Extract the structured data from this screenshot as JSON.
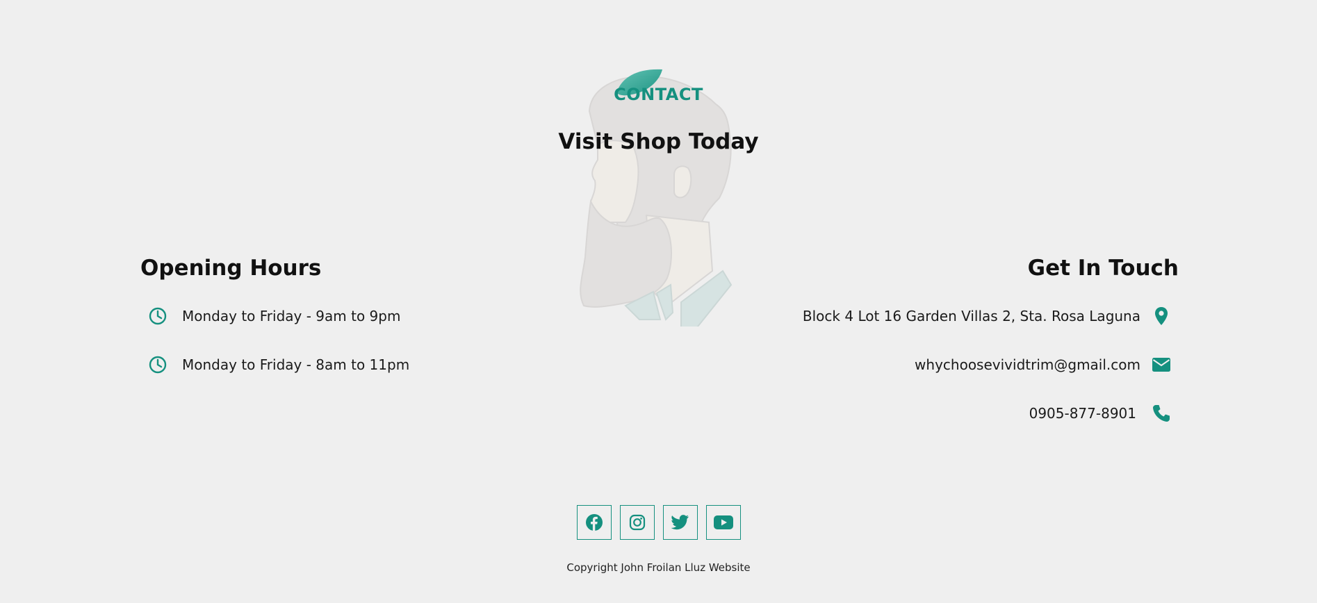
{
  "colors": {
    "accent": "#15907f",
    "background": "#efefef",
    "text": "#111111"
  },
  "header": {
    "label": "CONTACT",
    "title": "Visit Shop Today"
  },
  "opening_hours": {
    "title": "Opening Hours",
    "items": [
      {
        "icon": "clock-icon",
        "text": "Monday to Friday - 9am to 9pm"
      },
      {
        "icon": "clock-icon",
        "text": "Monday to Friday - 8am to 11pm"
      }
    ]
  },
  "get_in_touch": {
    "title": "Get In Touch",
    "items": [
      {
        "icon": "map-pin-icon",
        "text": "Block 4 Lot 16 Garden Villas 2, Sta. Rosa Laguna"
      },
      {
        "icon": "envelope-icon",
        "text": "whychoosevividtrim@gmail.com"
      },
      {
        "icon": "phone-icon",
        "text": "0905-877-8901"
      }
    ]
  },
  "social": [
    {
      "icon": "facebook-icon"
    },
    {
      "icon": "instagram-icon"
    },
    {
      "icon": "twitter-icon"
    },
    {
      "icon": "youtube-icon"
    }
  ],
  "footer": {
    "copyright": "Copyright John Froilan Lluz Website"
  }
}
